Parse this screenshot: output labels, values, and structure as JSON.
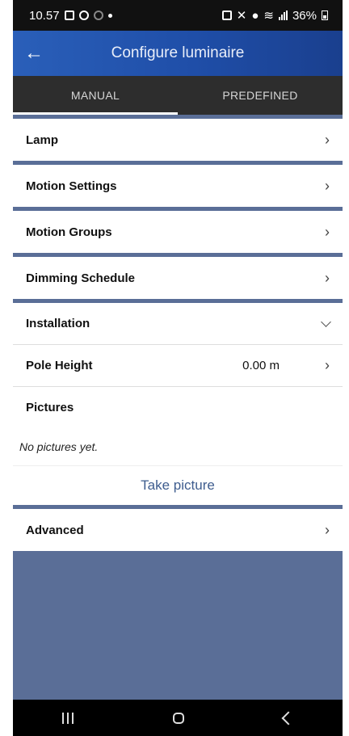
{
  "status_bar": {
    "time": "10.57",
    "battery": "36%"
  },
  "app_bar": {
    "title": "Configure luminaire",
    "back_icon": "arrow-left-icon"
  },
  "tabs": [
    {
      "label": "MANUAL",
      "active": true
    },
    {
      "label": "PREDEFINED",
      "active": false
    }
  ],
  "sections": [
    {
      "label": "Lamp"
    },
    {
      "label": "Motion Settings"
    },
    {
      "label": "Motion Groups"
    },
    {
      "label": "Dimming Schedule"
    }
  ],
  "installation": {
    "label": "Installation",
    "pole_height": {
      "label": "Pole Height",
      "value": "0.00 m"
    },
    "pictures": {
      "label": "Pictures",
      "empty_text": "No pictures yet.",
      "action": "Take picture"
    }
  },
  "advanced": {
    "label": "Advanced"
  },
  "colors": {
    "app_bar": "#1f4ea8",
    "tabs_bg": "#2d2d2d",
    "background": "#5a6e97",
    "link": "#3e5c8e"
  }
}
